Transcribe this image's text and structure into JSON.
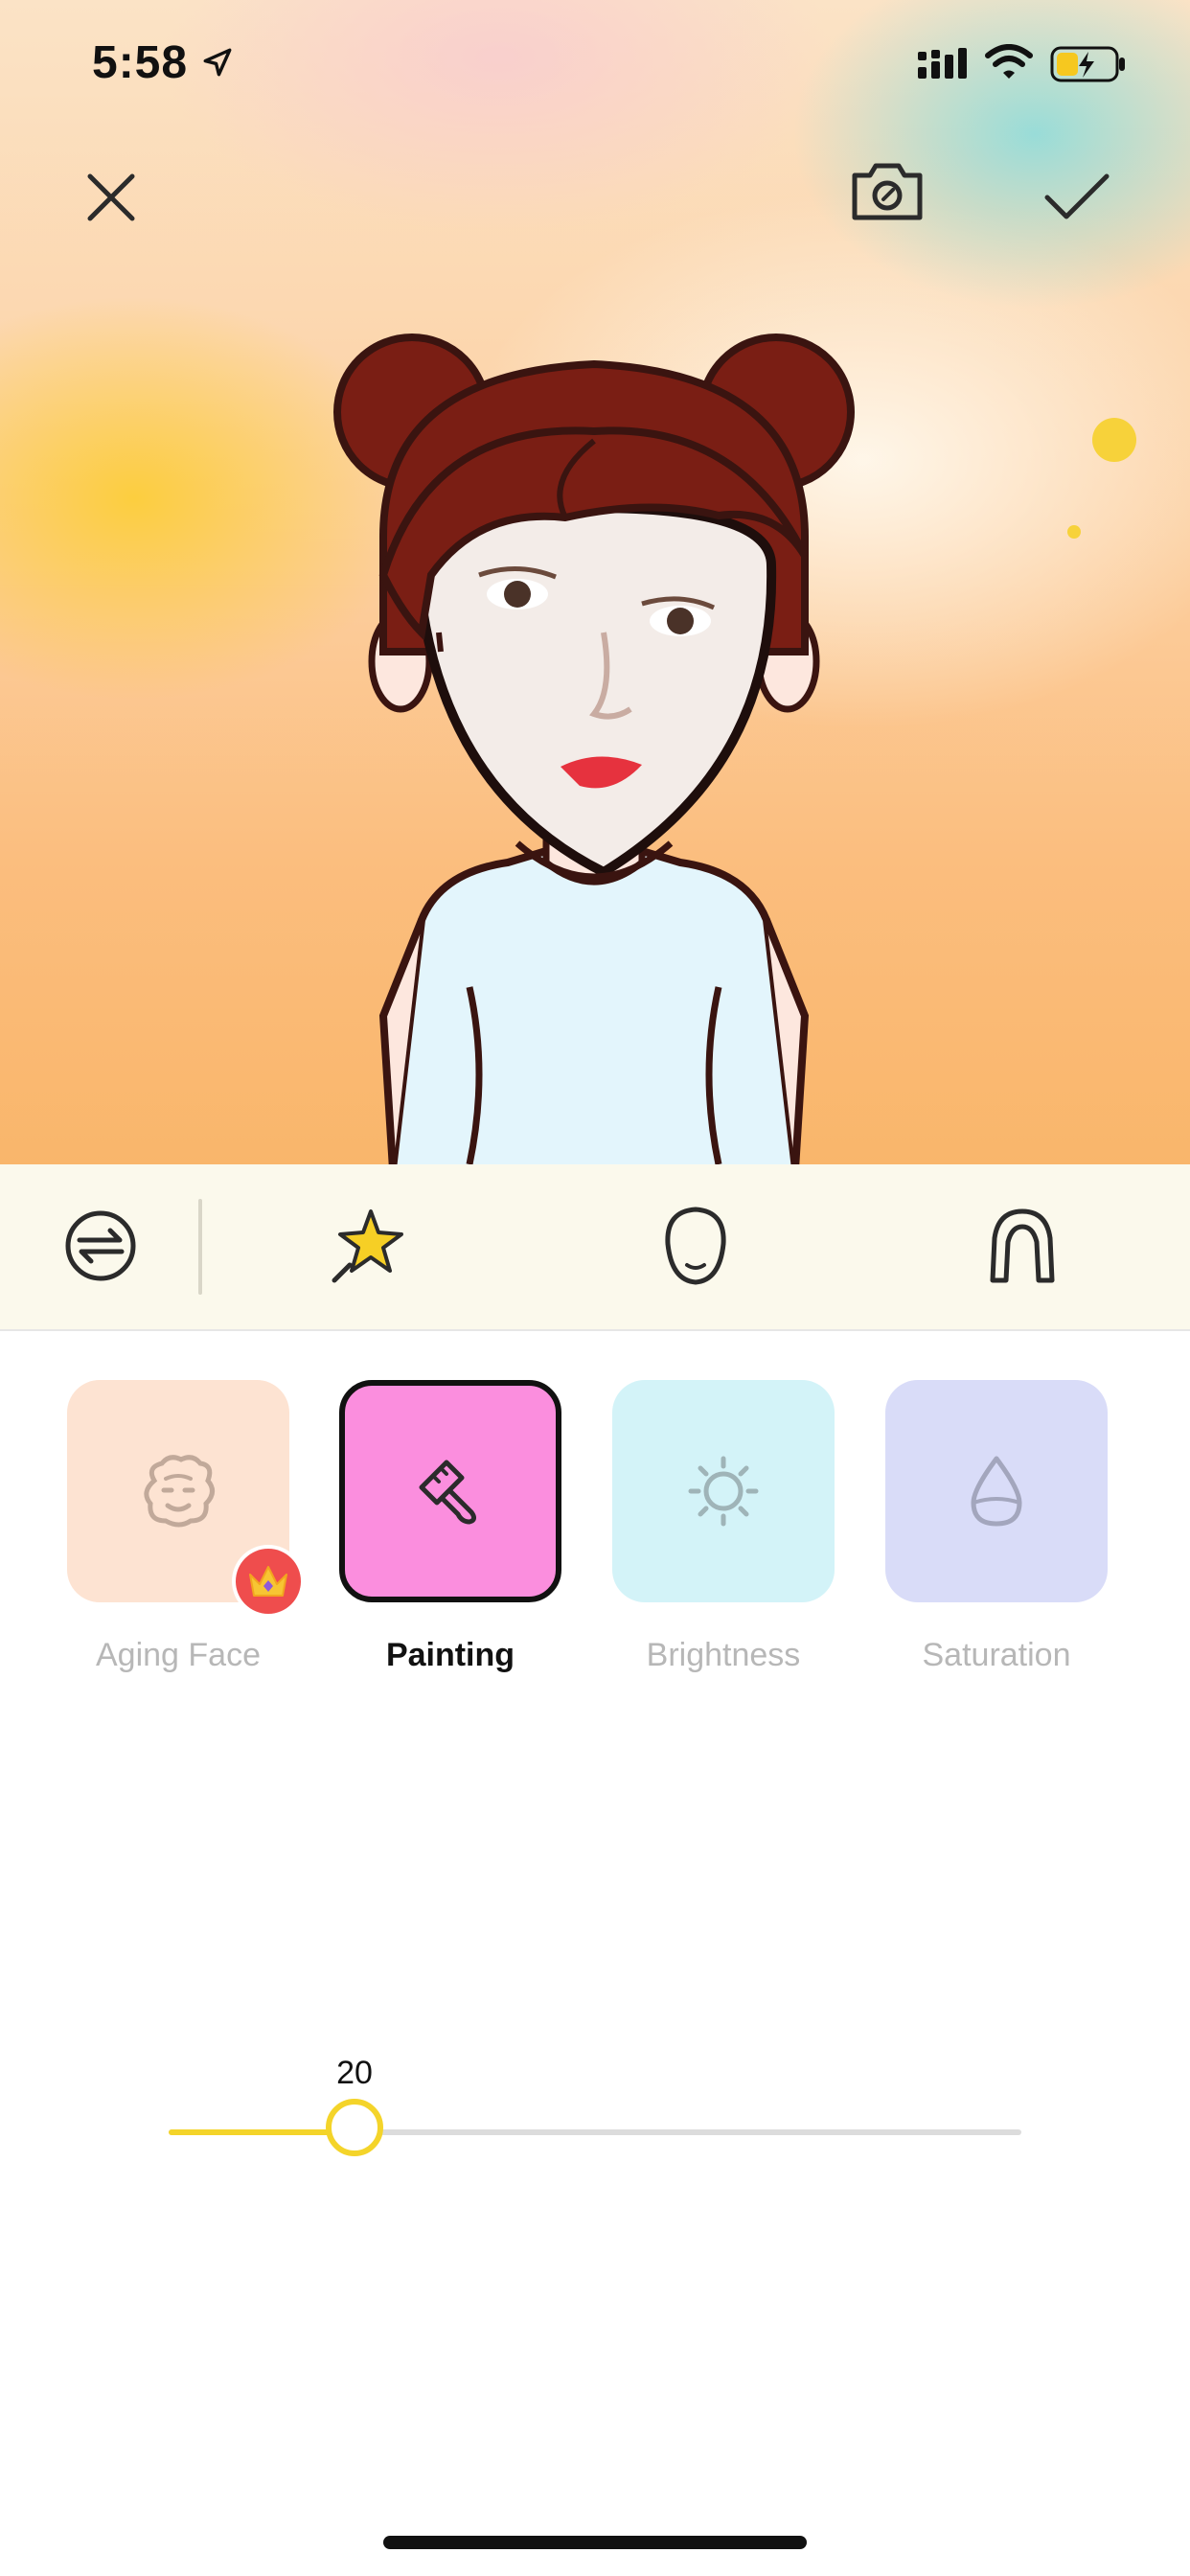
{
  "status_bar": {
    "time": "5:58",
    "icons": [
      "location-arrow-icon",
      "cellular-signal-icon",
      "wifi-icon",
      "battery-charging-icon"
    ]
  },
  "header": {
    "close_icon": "close-icon",
    "camera_icon": "camera-icon",
    "confirm_icon": "checkmark-icon"
  },
  "tools": [
    {
      "name": "swap-icon"
    },
    {
      "name": "magic-star-icon"
    },
    {
      "name": "face-shape-icon"
    },
    {
      "name": "hair-icon"
    }
  ],
  "filters": [
    {
      "label": "Aging Face",
      "color": "#fde3d2",
      "icon": "aging-face-icon",
      "premium": true,
      "active": false
    },
    {
      "label": "Painting",
      "color": "#fb8ede",
      "icon": "paint-brush-icon",
      "premium": false,
      "active": true
    },
    {
      "label": "Brightness",
      "color": "#d3f3f8",
      "icon": "sun-icon",
      "premium": false,
      "active": false
    },
    {
      "label": "Saturation",
      "color": "#d9dcf8",
      "icon": "drop-icon",
      "premium": false,
      "active": false
    }
  ],
  "slider": {
    "value": "20",
    "fraction": 0.2
  },
  "colors": {
    "accent": "#f4d42a",
    "toolbar_bg": "#fbf9ec"
  }
}
